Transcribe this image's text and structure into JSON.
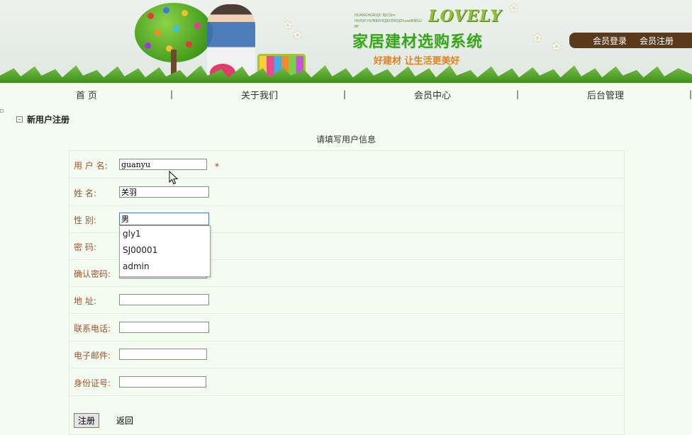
{
  "header": {
    "logo_small_lines": [
      "HUANGHGRUJC BJCQm",
      "HUIQH HUNBXHQJECEROJZhuanRNGU BY"
    ],
    "logo_brand": "LOVELY",
    "site_title": "家居建材选购系统",
    "site_slogan": "好建材 让生活更美好",
    "login_link": "会员登录",
    "register_link": "会员注册",
    "colors": {
      "title": "#3aa322",
      "slogan": "#e0831e",
      "login_bar": "#5a3a1a"
    }
  },
  "nav": {
    "items": [
      {
        "label": "首 页"
      },
      {
        "label": "关于我们"
      },
      {
        "label": "会员中心"
      },
      {
        "label": "后台管理"
      }
    ],
    "separator": "|"
  },
  "section": {
    "title": "新用户注册",
    "caption": "请填写用户信息"
  },
  "form": {
    "fields": [
      {
        "label": "用 户 名:",
        "value": "guanyu",
        "required_mark": "*"
      },
      {
        "label": "姓      名:",
        "value": "关羽"
      },
      {
        "label": "性      别:",
        "value": "男"
      },
      {
        "label": "密      码:",
        "value": ""
      },
      {
        "label": "确认密码:",
        "value": ""
      },
      {
        "label": "地      址:",
        "value": ""
      },
      {
        "label": "联系电话:",
        "value": ""
      },
      {
        "label": "电子邮件:",
        "value": ""
      },
      {
        "label": "身份证号:",
        "value": ""
      }
    ],
    "autocomplete_options": [
      "gly1",
      "SJ00001",
      "admin"
    ],
    "submit_label": "注册",
    "back_label": "返回",
    "label_color": "#a0522d"
  }
}
